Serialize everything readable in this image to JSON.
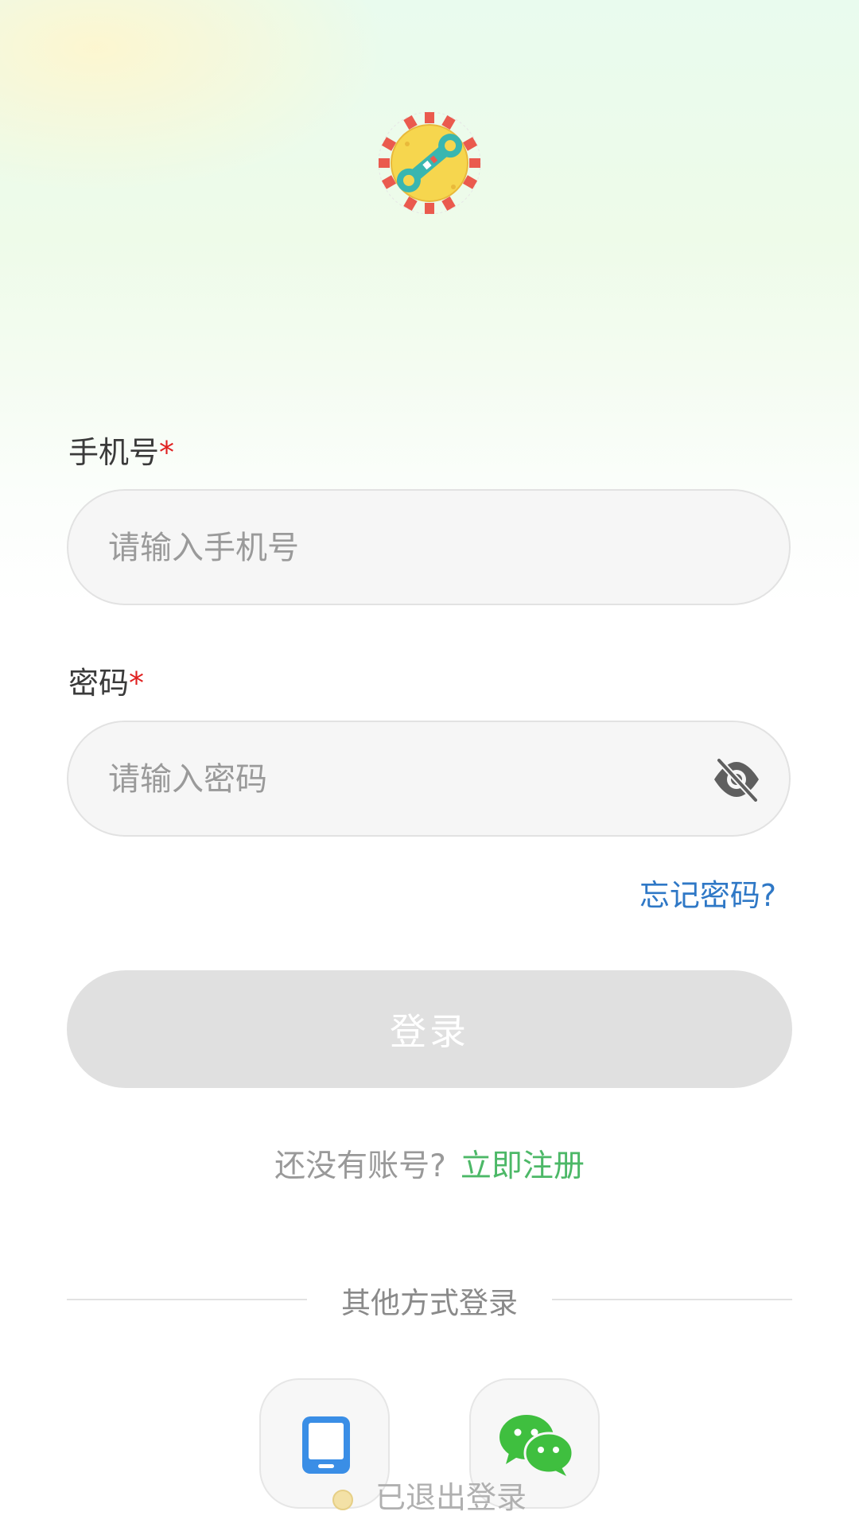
{
  "form": {
    "phone_label": "手机号",
    "phone_required": "*",
    "phone_placeholder": "请输入手机号",
    "phone_value": "",
    "password_label": "密码",
    "password_required": "*",
    "password_placeholder": "请输入密码",
    "password_value": "",
    "password_visibility_icon": "eye-off-icon",
    "forgot_link": "忘记密码?",
    "login_button": "登录"
  },
  "register": {
    "question": "还没有账号?",
    "link": "立即注册"
  },
  "other_login": {
    "divider_text": "其他方式登录",
    "methods": [
      {
        "icon": "phone-icon",
        "color": "#3a8ee6"
      },
      {
        "icon": "wechat-icon",
        "color": "#3fbf3f"
      }
    ]
  },
  "toast": {
    "message": "已退出登录"
  },
  "colors": {
    "accent_green": "#4cb867",
    "link_blue": "#2f78c6",
    "required_red": "#e02020",
    "button_disabled": "#e0e0e0"
  }
}
